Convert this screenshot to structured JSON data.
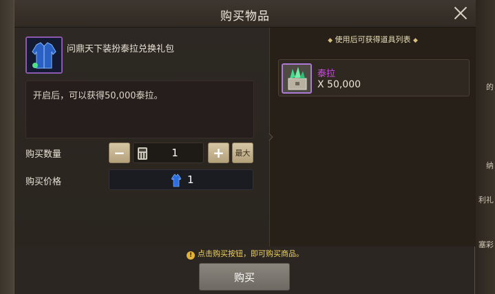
{
  "dialog": {
    "title": "购买物品",
    "close_icon": "close-icon"
  },
  "item": {
    "name": "问鼎天下装扮泰拉兑换礼包",
    "icon": "costume-package-icon",
    "description": "开启后，可以获得50,000泰拉。"
  },
  "purchase": {
    "quantity_label": "购买数量",
    "quantity_value": "1",
    "minus_label": "−",
    "plus_label": "+",
    "max_label": "最大",
    "price_label": "购买价格",
    "price_value": "1",
    "price_currency_icon": "blue-costume-icon"
  },
  "rewards": {
    "header": "使用后可获得道具列表",
    "items": [
      {
        "name": "泰拉",
        "count": "X 50,000",
        "icon": "tera-crystal-chest-icon"
      }
    ]
  },
  "footer": {
    "notice": "点击购买按钮，即可购买商品。",
    "buy_label": "购买"
  },
  "background": {
    "right_fragments": [
      "的",
      "纳",
      "利礼",
      "塞彩"
    ]
  },
  "colors": {
    "reward_name": "#d24be8",
    "notice": "#f0d35c",
    "item_border": "#8c5bb0"
  }
}
